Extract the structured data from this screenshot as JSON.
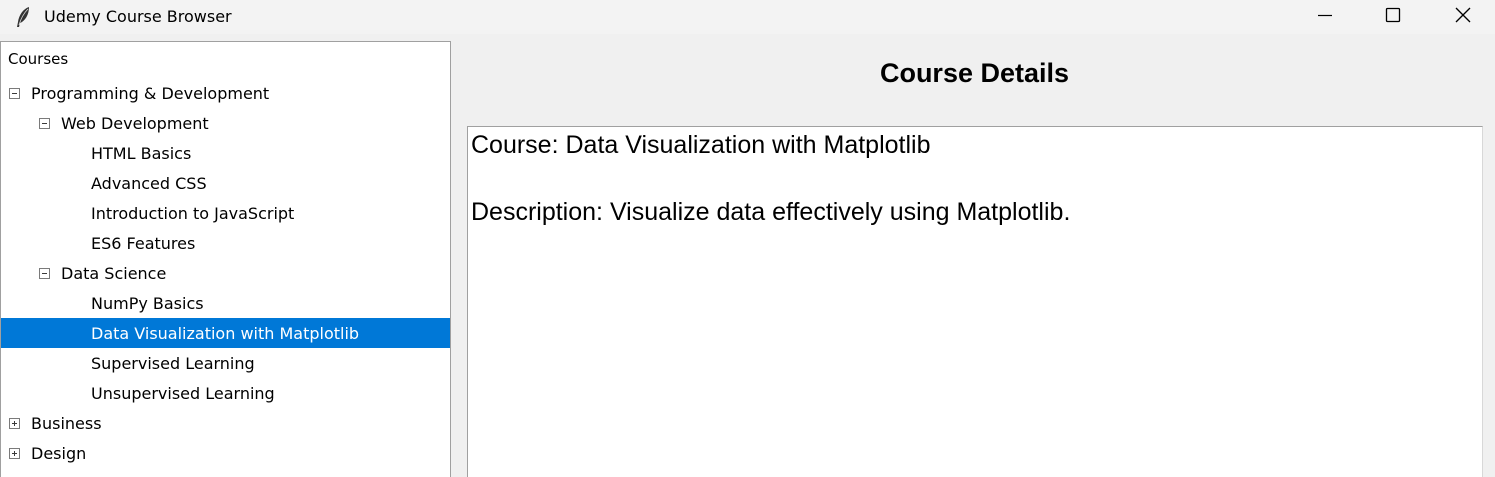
{
  "window": {
    "title": "Udemy Course Browser",
    "icon": "feather-icon",
    "controls": [
      "minimize-icon",
      "maximize-icon",
      "close-icon"
    ]
  },
  "tree": {
    "heading": "Courses",
    "selected_color": "#0078d7",
    "items": [
      {
        "label": "Programming & Development",
        "level": 0,
        "toggle": "expanded"
      },
      {
        "label": "Web Development",
        "level": 1,
        "toggle": "expanded"
      },
      {
        "label": "HTML Basics",
        "level": 2,
        "toggle": "none"
      },
      {
        "label": "Advanced CSS",
        "level": 2,
        "toggle": "none"
      },
      {
        "label": "Introduction to JavaScript",
        "level": 2,
        "toggle": "none"
      },
      {
        "label": "ES6 Features",
        "level": 2,
        "toggle": "none"
      },
      {
        "label": "Data Science",
        "level": 1,
        "toggle": "expanded"
      },
      {
        "label": "NumPy Basics",
        "level": 2,
        "toggle": "none"
      },
      {
        "label": "Data Visualization with Matplotlib",
        "level": 2,
        "toggle": "none",
        "selected": true
      },
      {
        "label": "Supervised Learning",
        "level": 2,
        "toggle": "none"
      },
      {
        "label": "Unsupervised Learning",
        "level": 2,
        "toggle": "none"
      },
      {
        "label": "Business",
        "level": 0,
        "toggle": "collapsed"
      },
      {
        "label": "Design",
        "level": 0,
        "toggle": "collapsed"
      }
    ]
  },
  "details": {
    "title": "Course Details",
    "course_line": "Course: Data Visualization with Matplotlib",
    "description_line": "Description: Visualize data effectively using Matplotlib."
  }
}
